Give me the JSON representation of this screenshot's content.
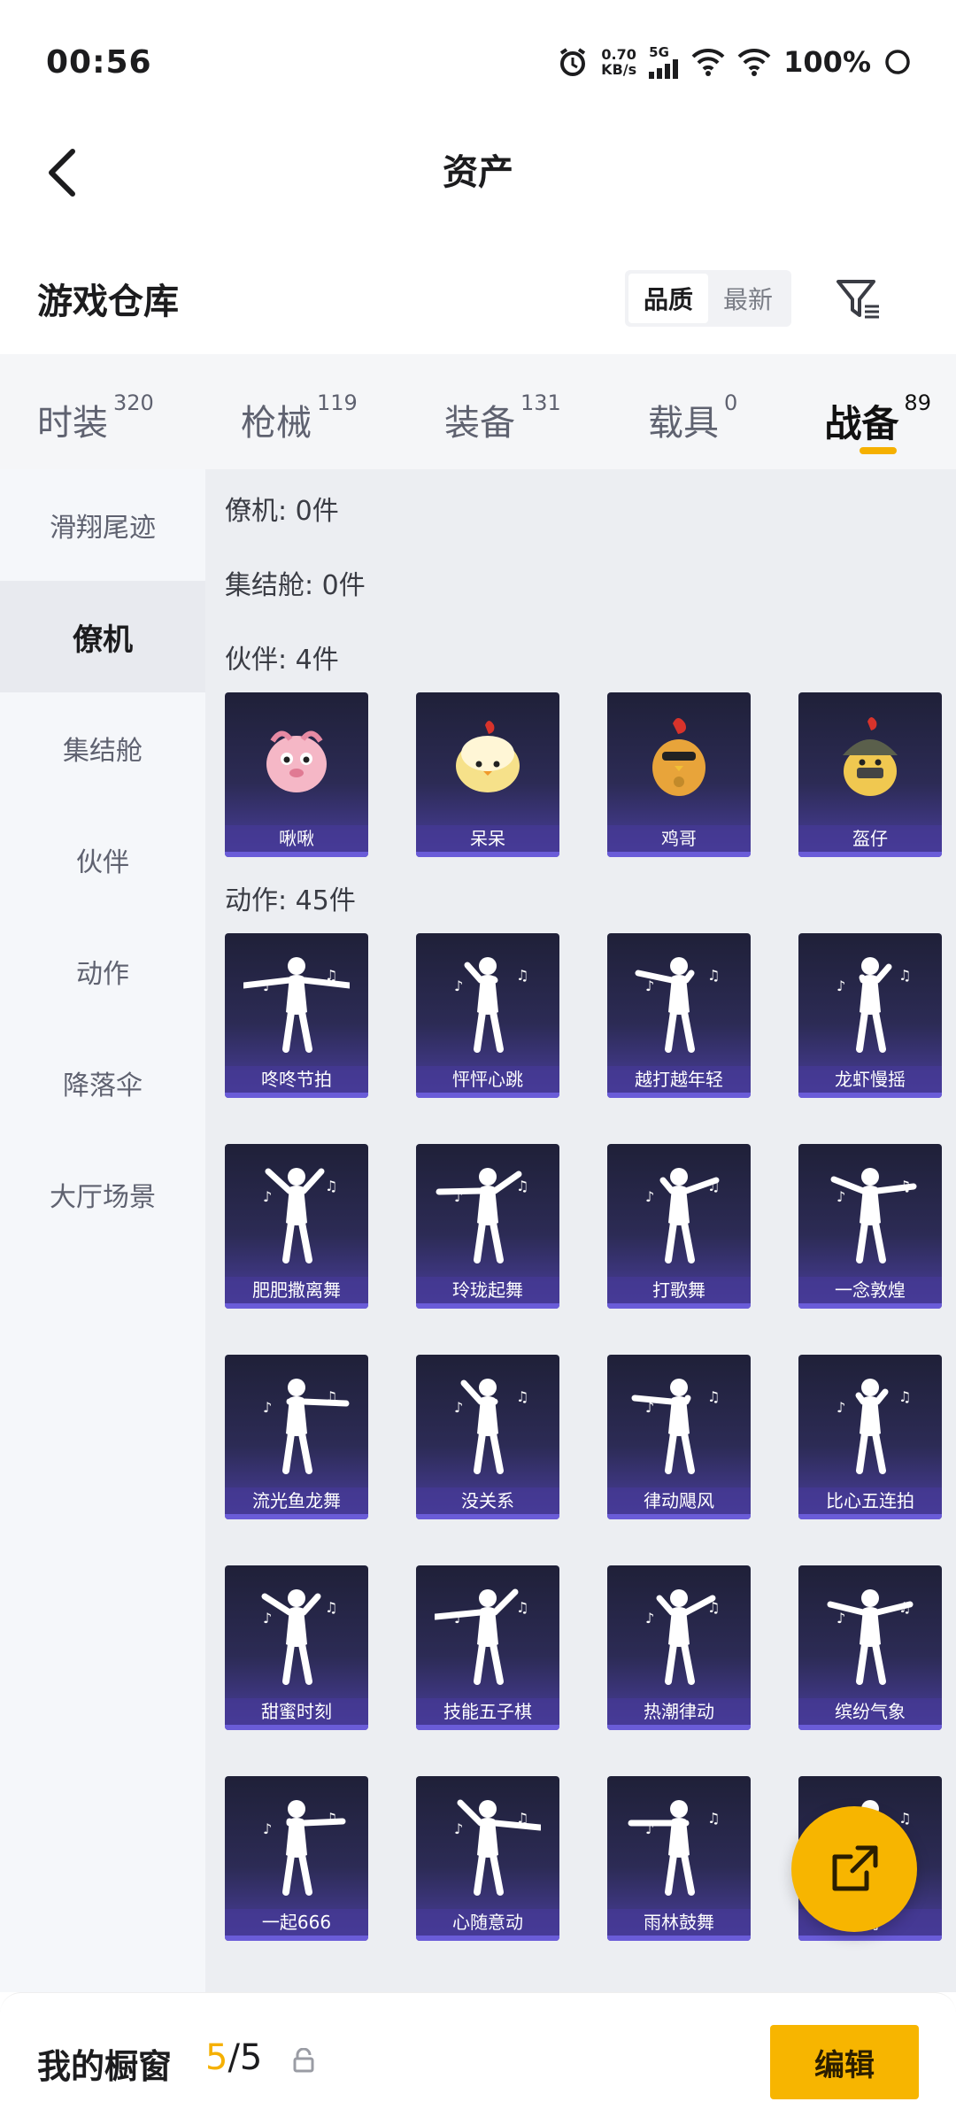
{
  "status_bar": {
    "time": "00:56",
    "net_speed_value": "0.70",
    "net_speed_unit": "KB/s",
    "network_type": "5G",
    "battery": "100%"
  },
  "nav": {
    "title": "资产"
  },
  "warehouse": {
    "title": "游戏仓库",
    "sort_options": [
      "品质",
      "最新"
    ],
    "sort_selected": "品质"
  },
  "category_tabs": [
    {
      "label": "时装",
      "count": "320",
      "active": false
    },
    {
      "label": "枪械",
      "count": "119",
      "active": false
    },
    {
      "label": "装备",
      "count": "131",
      "active": false
    },
    {
      "label": "载具",
      "count": "0",
      "active": false
    },
    {
      "label": "战备",
      "count": "89",
      "active": true
    }
  ],
  "sidebar": {
    "items": [
      {
        "label": "滑翔尾迹",
        "active": false
      },
      {
        "label": "僚机",
        "active": true
      },
      {
        "label": "集结舱",
        "active": false
      },
      {
        "label": "伙伴",
        "active": false
      },
      {
        "label": "动作",
        "active": false
      },
      {
        "label": "降落伞",
        "active": false
      },
      {
        "label": "大厅场景",
        "active": false
      }
    ]
  },
  "sections": {
    "wingman": "僚机: 0件",
    "rally": "集结舱: 0件",
    "partner": "伙伴: 4件",
    "emote": "动作: 45件"
  },
  "partners": [
    "啾啾",
    "呆呆",
    "鸡哥",
    "盔仔"
  ],
  "emotes": [
    "咚咚节拍",
    "怦怦心跳",
    "越打越年轻",
    "龙虾慢摇",
    "肥肥撒离舞",
    "玲珑起舞",
    "打歌舞",
    "一念敦煌",
    "流光鱼龙舞",
    "没关系",
    "律动飓风",
    "比心五连拍",
    "甜蜜时刻",
    "技能五子棋",
    "热潮律动",
    "缤纷气象",
    "一起666",
    "心随意动",
    "雨林鼓舞",
    "明"
  ],
  "bottom_bar": {
    "title": "我的橱窗",
    "count_current": "5",
    "count_total": "/5",
    "edit_label": "编辑"
  },
  "colors": {
    "accent": "#f7b500",
    "card_top": "#1f2038",
    "card_bottom": "#4b3fa0"
  }
}
